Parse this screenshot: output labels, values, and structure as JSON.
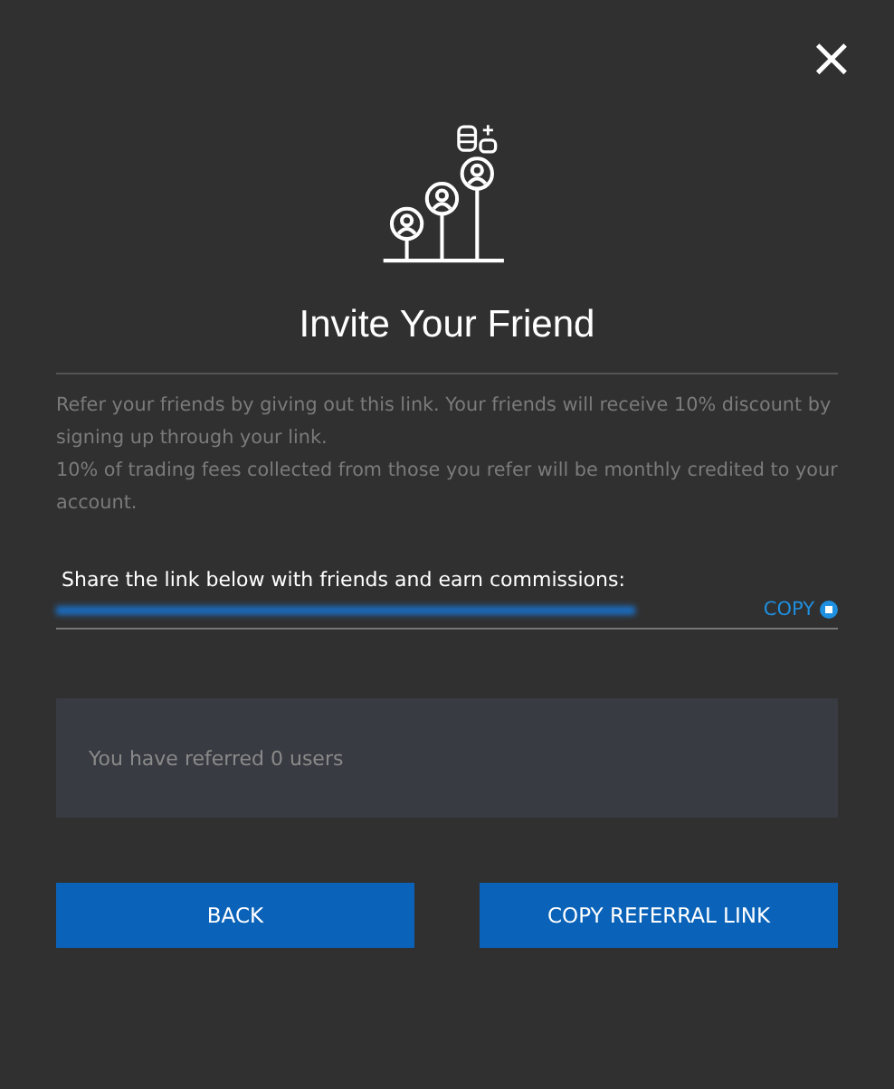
{
  "dialog": {
    "close": "×",
    "title": "Invite Your Friend",
    "description": [
      "Refer your friends by giving out this link. Your friends will receive 10% discount by signing up through your link.",
      "10% of trading fees collected from those you refer will be monthly credited to your account."
    ],
    "share_label": "Share the link below with friends and earn commissions:",
    "copy_link": "COPY",
    "referral_status": "You have referred 0 users",
    "buttons": [
      {
        "label": "BACK"
      },
      {
        "label": "COPY REFERRAL LINK"
      }
    ]
  }
}
